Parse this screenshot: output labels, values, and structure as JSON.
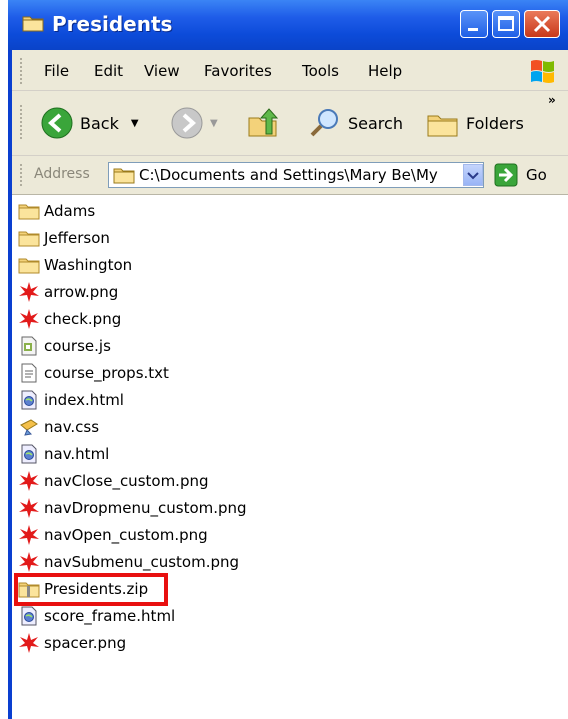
{
  "window": {
    "title": "Presidents"
  },
  "menu": [
    "File",
    "Edit",
    "View",
    "Favorites",
    "Tools",
    "Help"
  ],
  "toolbar": {
    "back_label": "Back",
    "search_label": "Search",
    "folders_label": "Folders"
  },
  "address": {
    "label": "Address",
    "path": "C:\\Documents and Settings\\Mary Be\\My",
    "go_label": "Go"
  },
  "files": [
    {
      "name": "Adams",
      "icon": "folder-icon"
    },
    {
      "name": "Jefferson",
      "icon": "folder-icon"
    },
    {
      "name": "Washington",
      "icon": "folder-icon"
    },
    {
      "name": "arrow.png",
      "icon": "png-image-icon"
    },
    {
      "name": "check.png",
      "icon": "png-image-icon"
    },
    {
      "name": "course.js",
      "icon": "script-file-icon"
    },
    {
      "name": "course_props.txt",
      "icon": "text-file-icon"
    },
    {
      "name": "index.html",
      "icon": "html-file-icon"
    },
    {
      "name": "nav.css",
      "icon": "css-file-icon"
    },
    {
      "name": "nav.html",
      "icon": "html-file-icon"
    },
    {
      "name": "navClose_custom.png",
      "icon": "png-image-icon"
    },
    {
      "name": "navDropmenu_custom.png",
      "icon": "png-image-icon"
    },
    {
      "name": "navOpen_custom.png",
      "icon": "png-image-icon"
    },
    {
      "name": "navSubmenu_custom.png",
      "icon": "png-image-icon"
    },
    {
      "name": "Presidents.zip",
      "icon": "zip-folder-icon"
    },
    {
      "name": "score_frame.html",
      "icon": "html-file-icon"
    },
    {
      "name": "spacer.png",
      "icon": "png-image-icon"
    }
  ],
  "colors": {
    "titlebar": "#0c4bd9",
    "highlight_border": "#e81010",
    "chrome": "#ece9d8"
  }
}
